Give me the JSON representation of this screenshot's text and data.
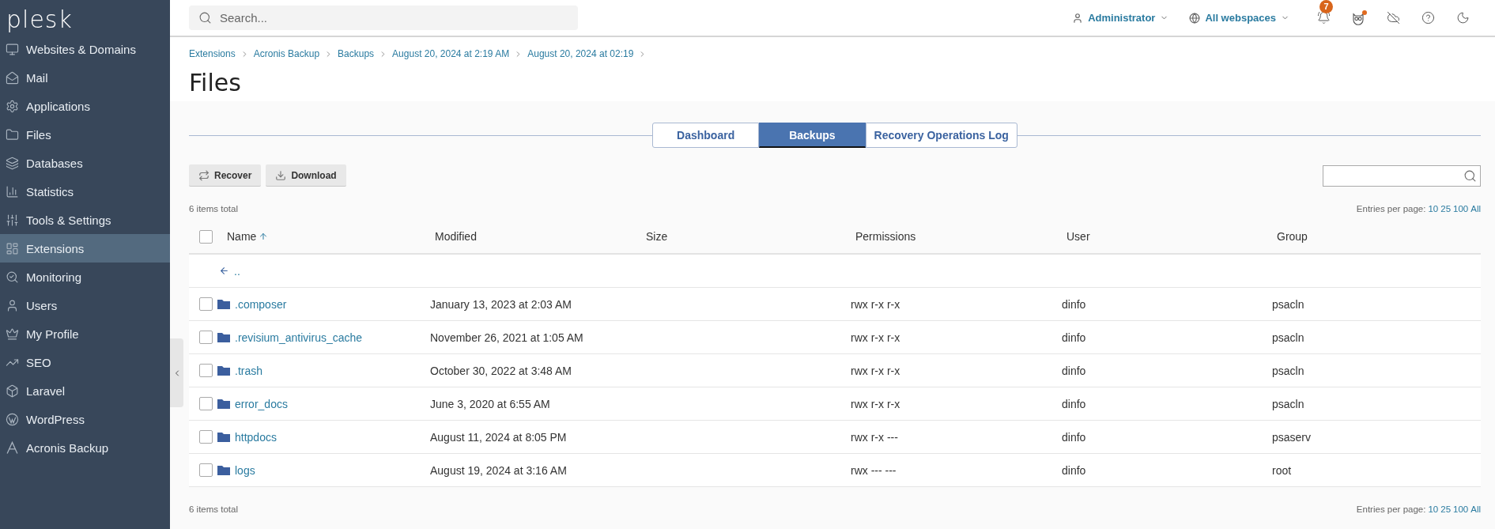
{
  "sidebar": {
    "logo": "plesk",
    "items": [
      {
        "label": "Websites & Domains",
        "selected": false
      },
      {
        "label": "Mail",
        "selected": false
      },
      {
        "label": "Applications",
        "selected": false
      },
      {
        "label": "Files",
        "selected": false
      },
      {
        "label": "Databases",
        "selected": false
      },
      {
        "label": "Statistics",
        "selected": false
      },
      {
        "label": "Tools & Settings",
        "selected": false
      },
      {
        "label": "Extensions",
        "selected": true
      },
      {
        "label": "Monitoring",
        "selected": false
      },
      {
        "label": "Users",
        "selected": false
      },
      {
        "label": "My Profile",
        "selected": false
      },
      {
        "label": "SEO",
        "selected": false
      },
      {
        "label": "Laravel",
        "selected": false
      },
      {
        "label": "WordPress",
        "selected": false
      },
      {
        "label": "Acronis Backup",
        "selected": false
      }
    ]
  },
  "top_bar": {
    "search": {
      "placeholder": "Search..."
    },
    "account": "Administrator",
    "webspaces": "All webspaces",
    "notifications": {
      "count": "7"
    },
    "updates": {
      "dot": true
    }
  },
  "breadcrumbs": [
    "Extensions",
    "Acronis Backup",
    "Backups",
    "August 20, 2024 at 2:19 AM",
    "August 20, 2024 at 02:19"
  ],
  "title": "Files",
  "tabs": [
    {
      "label": "Dashboard",
      "selected": false
    },
    {
      "label": "Backups",
      "selected": true
    },
    {
      "label": "Recovery Operations Log",
      "selected": false
    }
  ],
  "toolbar": {
    "buttons": [
      "Recover",
      "Download"
    ]
  },
  "summary_top": {
    "total": "6 items total",
    "entries_label": "Entries per page:",
    "entries_options": [
      "10",
      "25",
      "100",
      "All"
    ]
  },
  "table": {
    "select_all": {
      "checked": false
    },
    "columns": [
      {
        "label": "Name",
        "sorted": true
      },
      {
        "label": "Modified",
        "sorted": false
      },
      {
        "label": "Size",
        "sorted": false
      },
      {
        "label": "Permissions",
        "sorted": false
      },
      {
        "label": "User",
        "sorted": false
      },
      {
        "label": "Group",
        "sorted": false
      }
    ],
    "parent_row": {
      "label": ".."
    },
    "rows": [
      {
        "name": ".composer",
        "modified": "January 13, 2023 at 2:03 AM",
        "permissions": "rwx r-x r-x",
        "user": "dinfo",
        "group": "psacln",
        "checked": false
      },
      {
        "name": ".revisium_antivirus_cache",
        "modified": "November 26, 2021 at 1:05 AM",
        "permissions": "rwx r-x r-x",
        "user": "dinfo",
        "group": "psacln",
        "checked": false
      },
      {
        "name": ".trash",
        "modified": "October 30, 2022 at 3:48 AM",
        "permissions": "rwx r-x r-x",
        "user": "dinfo",
        "group": "psacln",
        "checked": false
      },
      {
        "name": "error_docs",
        "modified": "June 3, 2020 at 6:55 AM",
        "permissions": "rwx r-x r-x",
        "user": "dinfo",
        "group": "psacln",
        "checked": false
      },
      {
        "name": "httpdocs",
        "modified": "August 11, 2024 at 8:05 PM",
        "permissions": "rwx r-x ---",
        "user": "dinfo",
        "group": "psaserv",
        "checked": false
      },
      {
        "name": "logs",
        "modified": "August 19, 2024 at 3:16 AM",
        "permissions": "rwx --- ---",
        "user": "dinfo",
        "group": "root",
        "checked": false
      }
    ]
  },
  "summary_bottom": {
    "total": "6 items total",
    "entries_label": "Entries per page:",
    "entries_options": [
      "10",
      "25",
      "100",
      "All"
    ]
  }
}
